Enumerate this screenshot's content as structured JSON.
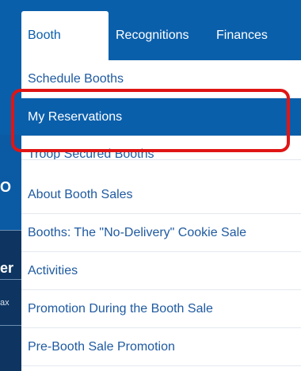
{
  "nav": {
    "tabs": [
      {
        "label": "Booth",
        "active": true
      },
      {
        "label": "Recognitions"
      },
      {
        "label": "Finances"
      }
    ]
  },
  "booth_menu": {
    "items": [
      {
        "label": "Schedule Booths"
      },
      {
        "label": "My Reservations",
        "selected": true
      },
      {
        "label": "Troop Secured Booths"
      },
      {
        "label": "About Booth Sales"
      },
      {
        "label": "Booths: The \"No-Delivery\" Cookie Sale"
      },
      {
        "label": "Activities"
      },
      {
        "label": "Promotion During the Booth Sale"
      },
      {
        "label": "Pre-Booth Sale Promotion"
      }
    ]
  },
  "background_fragments": {
    "frag1": "O",
    "frag2": "er",
    "frag3": "ax"
  },
  "colors": {
    "brand_blue": "#0a5fab",
    "highlight_red": "#e01515"
  }
}
